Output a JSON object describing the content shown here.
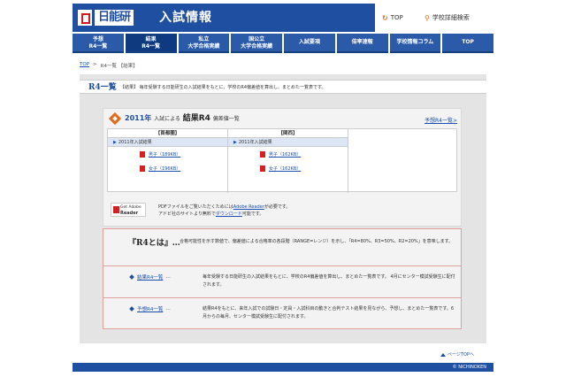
{
  "header": {
    "logo_text": "日能研",
    "site_title": "入試情報",
    "top_label": "TOP",
    "search_label": "学校詳細検索"
  },
  "nav": [
    {
      "line1": "予想",
      "line2": "R4一覧"
    },
    {
      "line1": "結果",
      "line2": "R4一覧"
    },
    {
      "line1": "私立",
      "line2": "大学合格実績"
    },
    {
      "line1": "国公立",
      "line2": "大学合格実績"
    },
    {
      "line1": "入試要項",
      "line2": ""
    },
    {
      "line1": "倍率速報",
      "line2": ""
    },
    {
      "line1": "学校情報コラム",
      "line2": ""
    },
    {
      "line1": "TOP",
      "line2": ""
    }
  ],
  "breadcrumb": {
    "top": "TOP",
    "sep": ">",
    "current": "R4一覧 【結果】"
  },
  "r4": {
    "title": "R4一覧",
    "desc": "【結果】 毎年受験する日能研生の入試結果をもとに、学校のR4偏差値を算出し、まとめた一覧表です。"
  },
  "year_box": {
    "year": "2011年",
    "by": "入試による",
    "main": "結果R4",
    "sub": "偏差値一覧",
    "forecast_link": "予想R4一覧>",
    "columns": [
      {
        "head": "【首都圏】",
        "sub": "2011年入試結果",
        "files": [
          {
            "label": "男子（189KB）"
          },
          {
            "label": "女子（196KB）"
          }
        ]
      },
      {
        "head": "【関西】",
        "sub": "2011年入試結果",
        "files": [
          {
            "label": "男子（162KB）"
          },
          {
            "label": "女子（162KB）"
          }
        ]
      }
    ]
  },
  "adobe": {
    "badge_line1": "Get Adobe",
    "badge_line2": "Reader",
    "text1_pre": "PDFファイルをご覧いただくためには",
    "text1_link": "Adobe Reader",
    "text1_post": "が必要です。",
    "text2_pre": "アドビ社のサイトより無料で",
    "text2_link": "ダウンロード",
    "text2_post": "可能です。"
  },
  "r4_info": {
    "what_title": "『R4とは』…",
    "what_desc": "合格可能性を示す数値で、偏差値による合格率の各段階（RANGE=レンジ）を示し、「R4=80%、R3=50%、R2=20%」を意味します。",
    "items": [
      {
        "link": "結果R4一覧",
        "dots": "…",
        "desc": "毎年受験する日能研生の入試結果をもとに、学校のR4偏差値を算出し、まとめた一覧表です。 4月にセンター模試受験生に配付されます。"
      },
      {
        "link": "予想R4一覧",
        "dots": "…",
        "desc": "結果R4をもとに、来年入試での試験日・定員・入試科目の動きと合判テスト結果を見ながら、予想し、まとめた一覧表です。6月からの毎月、センター模試受験生に配付されます。"
      }
    ]
  },
  "footer": {
    "pagetop": "ページTOPへ",
    "copyright": "© NICHINOKEN"
  }
}
